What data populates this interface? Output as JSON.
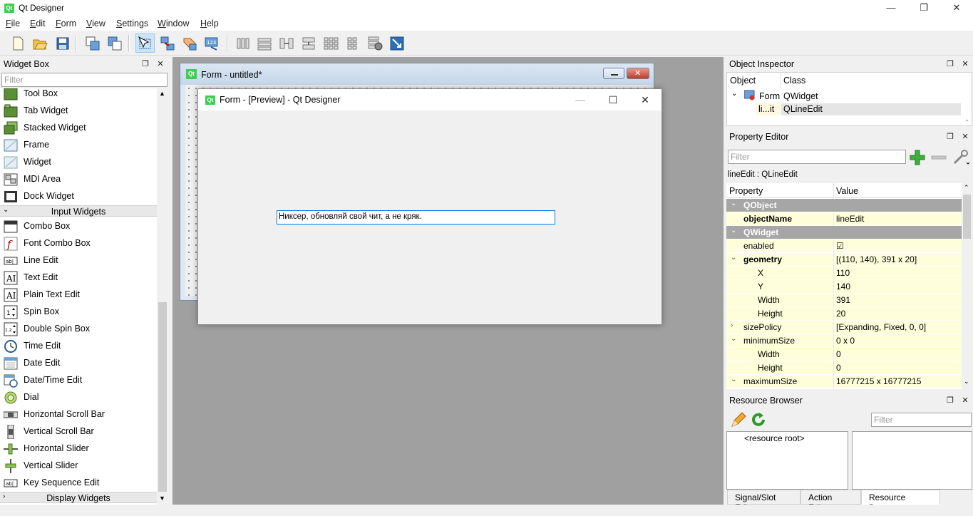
{
  "window": {
    "title": "Qt Designer",
    "icon_text": "Qt",
    "minimize": "—",
    "restore": "❐",
    "close": "✕"
  },
  "menu": [
    {
      "u": "F",
      "rest": "ile"
    },
    {
      "u": "E",
      "rest": "dit"
    },
    {
      "u": "F",
      "rest": "orm"
    },
    {
      "u": "V",
      "rest": "iew"
    },
    {
      "u": "S",
      "rest": "ettings"
    },
    {
      "u": "W",
      "rest": "indow"
    },
    {
      "u": "H",
      "rest": "elp"
    }
  ],
  "widget_box": {
    "title": "Widget Box",
    "filter_placeholder": "Filter",
    "items": [
      {
        "label": "Tool Box",
        "icon": "toolbox-icon"
      },
      {
        "label": "Tab Widget",
        "icon": "tab-widget-icon"
      },
      {
        "label": "Stacked Widget",
        "icon": "stacked-widget-icon"
      },
      {
        "label": "Frame",
        "icon": "frame-icon"
      },
      {
        "label": "Widget",
        "icon": "widget-icon"
      },
      {
        "label": "MDI Area",
        "icon": "mdi-area-icon"
      },
      {
        "label": "Dock Widget",
        "icon": "dock-widget-icon"
      }
    ],
    "category_input": "Input Widgets",
    "input_items": [
      {
        "label": "Combo Box",
        "icon": "combo-box-icon"
      },
      {
        "label": "Font Combo Box",
        "icon": "font-combo-box-icon"
      },
      {
        "label": "Line Edit",
        "icon": "line-edit-icon"
      },
      {
        "label": "Text Edit",
        "icon": "text-edit-icon"
      },
      {
        "label": "Plain Text Edit",
        "icon": "plain-text-edit-icon"
      },
      {
        "label": "Spin Box",
        "icon": "spin-box-icon"
      },
      {
        "label": "Double Spin Box",
        "icon": "double-spin-box-icon"
      },
      {
        "label": "Time Edit",
        "icon": "time-edit-icon"
      },
      {
        "label": "Date Edit",
        "icon": "date-edit-icon"
      },
      {
        "label": "Date/Time Edit",
        "icon": "datetime-edit-icon"
      },
      {
        "label": "Dial",
        "icon": "dial-icon"
      },
      {
        "label": "Horizontal Scroll Bar",
        "icon": "horizontal-scroll-bar-icon"
      },
      {
        "label": "Vertical Scroll Bar",
        "icon": "vertical-scroll-bar-icon"
      },
      {
        "label": "Horizontal Slider",
        "icon": "horizontal-slider-icon"
      },
      {
        "label": "Vertical Slider",
        "icon": "vertical-slider-icon"
      },
      {
        "label": "Key Sequence Edit",
        "icon": "key-sequence-edit-icon"
      }
    ],
    "category_display": "Display Widgets"
  },
  "form_window": {
    "title": "Form - untitled*"
  },
  "preview_window": {
    "title": "Form - [Preview] - Qt Designer",
    "line_edit_text": "Никсер, обновляй свой чит, а не кряк."
  },
  "object_inspector": {
    "title": "Object Inspector",
    "col_object": "Object",
    "col_class": "Class",
    "rows": [
      {
        "object": "Form",
        "class": "QWidget"
      },
      {
        "object": "li...it",
        "class": "QLineEdit"
      }
    ]
  },
  "property_editor": {
    "title": "Property Editor",
    "filter_placeholder": "Filter",
    "subject": "lineEdit : QLineEdit",
    "col_property": "Property",
    "col_value": "Value",
    "rows": [
      {
        "k": "QObject",
        "v": "",
        "kind": "group"
      },
      {
        "k": "objectName",
        "v": "lineEdit",
        "kind": "bold"
      },
      {
        "k": "QWidget",
        "v": "",
        "kind": "group"
      },
      {
        "k": "enabled",
        "v": "☑",
        "kind": "normal"
      },
      {
        "k": "geometry",
        "v": "[(110, 140), 391 x 20]",
        "kind": "bold-exp"
      },
      {
        "k": "X",
        "v": "110",
        "kind": "sub"
      },
      {
        "k": "Y",
        "v": "140",
        "kind": "sub"
      },
      {
        "k": "Width",
        "v": "391",
        "kind": "sub"
      },
      {
        "k": "Height",
        "v": "20",
        "kind": "sub"
      },
      {
        "k": "sizePolicy",
        "v": "[Expanding, Fixed, 0, 0]",
        "kind": "collapsed"
      },
      {
        "k": "minimumSize",
        "v": "0 x 0",
        "kind": "expanded"
      },
      {
        "k": "Width",
        "v": "0",
        "kind": "sub"
      },
      {
        "k": "Height",
        "v": "0",
        "kind": "sub"
      },
      {
        "k": "maximumSize",
        "v": "16777215 x 16777215",
        "kind": "expanded"
      }
    ]
  },
  "resource_browser": {
    "title": "Resource Browser",
    "filter_placeholder": "Filter",
    "root": "<resource root>"
  },
  "bottom_tabs": [
    "Signal/Slot Editor",
    "Action Editor",
    "Resource Browser"
  ],
  "colors": {
    "group_row": "#a6a6a6",
    "yellow_row": "#fffedb",
    "accent": "#0078d7"
  }
}
